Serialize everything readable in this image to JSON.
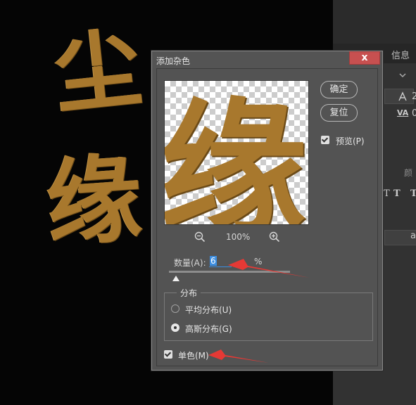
{
  "canvas": {
    "text_top": "尘",
    "text_bottom": "缘"
  },
  "right_panel": {
    "tab_label": "信息",
    "row1_text": "2",
    "row2_prefix": "VA",
    "row2_text": "0",
    "color_label": "颜",
    "text_style_T": "T",
    "text_style_T2": "T",
    "row_a_text": "a"
  },
  "dialog": {
    "title": "添加杂色",
    "close_glyph": "x",
    "ok_label": "确定",
    "reset_label": "复位",
    "preview_label": "预览(P)",
    "preview_checked": true,
    "preview_char": "缘",
    "zoom_level": "100%",
    "amount_label": "数量(A):",
    "amount_value": "6",
    "amount_unit": "%",
    "distribution_label": "分布",
    "uniform_label": "平均分布(U)",
    "gaussian_label": "高斯分布(G)",
    "selected_distribution": "gaussian",
    "monochromatic_label": "单色(M)",
    "monochromatic_checked": true
  },
  "colors": {
    "gold": "#a8782d",
    "dialog_bg": "#535353",
    "close_red": "#c75050",
    "annotation_red": "#e53935",
    "selection_blue": "#3d8ee0"
  }
}
